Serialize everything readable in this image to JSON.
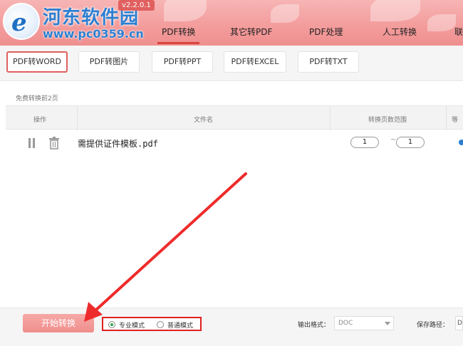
{
  "header": {
    "watermark_title": "河东软件园",
    "watermark_url": "www.pc0359.cn",
    "version": "v2.2.0.1",
    "nav_tabs": [
      {
        "label": "PDF转换",
        "active": true
      },
      {
        "label": "其它转PDF",
        "active": false
      },
      {
        "label": "PDF处理",
        "active": false
      },
      {
        "label": "人工转换",
        "active": false
      },
      {
        "label": "联",
        "active": false
      }
    ]
  },
  "subtabs": [
    {
      "label": "PDF转WORD",
      "active": true
    },
    {
      "label": "PDF转图片",
      "active": false
    },
    {
      "label": "PDF转PPT",
      "active": false
    },
    {
      "label": "PDF转EXCEL",
      "active": false
    },
    {
      "label": "PDF转TXT",
      "active": false
    }
  ],
  "table": {
    "free_note": "免费转换前2页",
    "headers": {
      "action": "操作",
      "filename": "文件名",
      "page_range": "转换页数范围",
      "extra": "等"
    },
    "rows": [
      {
        "filename": "需提供证件模板.pdf",
        "page_from": "1",
        "page_to": "1"
      }
    ],
    "range_sep": "~"
  },
  "bottom": {
    "start_button": "开始转换",
    "modes": [
      {
        "label": "专业模式",
        "checked": true
      },
      {
        "label": "普通模式",
        "checked": false
      }
    ],
    "output_format_label": "输出格式：",
    "output_format_value": "DOC",
    "save_path_label": "保存路径：",
    "save_path_value": "D:"
  },
  "colors": {
    "header_bg": "#f39b9b",
    "accent_red": "#e0605f",
    "highlight_box": "#e01f1f",
    "start_button": "#ef8e8c",
    "watermark_blue": "#2c7fd1"
  }
}
